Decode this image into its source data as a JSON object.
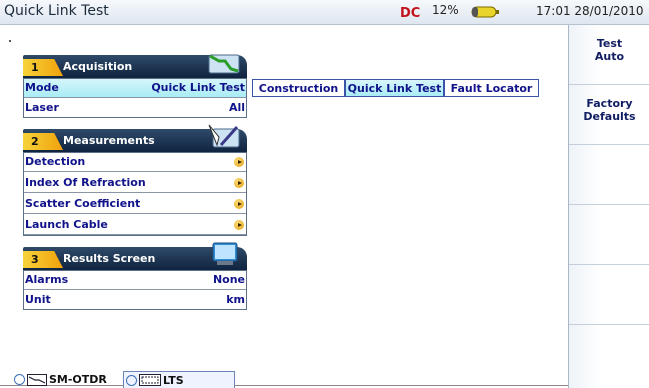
{
  "header": {
    "title": "Quick Link Test",
    "battery_percent": "12%",
    "clock": "17:01 28/01/2010"
  },
  "sections": [
    {
      "number": "1",
      "title": "Acquisition",
      "icon": "acquisition-trace-icon",
      "rows": [
        {
          "label": "Mode",
          "value": "Quick Link Test"
        },
        {
          "label": "Laser",
          "value": "All"
        }
      ]
    },
    {
      "number": "2",
      "title": "Measurements",
      "icon": "measurement-pen-icon",
      "rows": [
        {
          "label": "Detection"
        },
        {
          "label": "Index Of Refraction"
        },
        {
          "label": "Scatter Coefficient"
        },
        {
          "label": "Launch Cable"
        }
      ]
    },
    {
      "number": "3",
      "title": "Results Screen",
      "icon": "monitor-icon",
      "rows": [
        {
          "label": "Alarms",
          "value": "None"
        },
        {
          "label": "Unit",
          "value": "km"
        }
      ]
    }
  ],
  "mode_options": [
    "Construction",
    "Quick Link Test",
    "Fault Locator"
  ],
  "mode_selected": "Quick Link Test",
  "sidebar": {
    "buttons": [
      {
        "line1": "Test",
        "line2": "Auto"
      },
      {
        "line1": "Factory",
        "line2": "Defaults"
      }
    ]
  },
  "tabs": [
    {
      "label": "SM-OTDR"
    },
    {
      "label": "LTS"
    }
  ],
  "colors": {
    "header_dark": "#0f243f",
    "accent_yellow": "#f0a20c",
    "highlight_cyan": "#a9ecf6",
    "text_blue": "#10138a"
  }
}
